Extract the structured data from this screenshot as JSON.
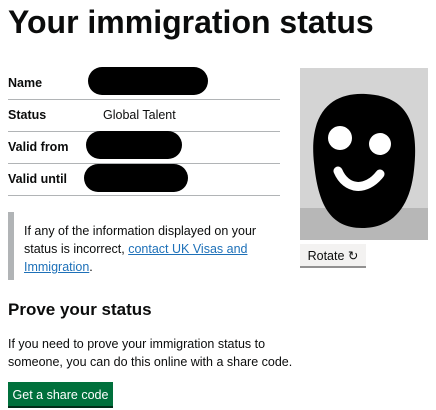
{
  "page": {
    "title": "Your immigration status"
  },
  "summary": {
    "rows": [
      {
        "key": "Name",
        "value": ""
      },
      {
        "key": "Status",
        "value": "Global Talent"
      },
      {
        "key": "Valid from",
        "value": ""
      },
      {
        "key": "Valid until",
        "value": ""
      }
    ]
  },
  "inset": {
    "text_before": "If any of the information displayed on your status is incorrect, ",
    "link_text": "contact UK Visas and Immigration",
    "text_after": "."
  },
  "photo": {
    "rotate_label": "Rotate ↻"
  },
  "prove": {
    "heading": "Prove your status",
    "body": "If you need to prove your immigration status to someone, you can do this online with a share code.",
    "button_label": "Get a share code"
  },
  "colors": {
    "link": "#1d70b8",
    "primary_button": "#00703c",
    "border": "#b1b4b6",
    "text": "#0b0c0c"
  }
}
